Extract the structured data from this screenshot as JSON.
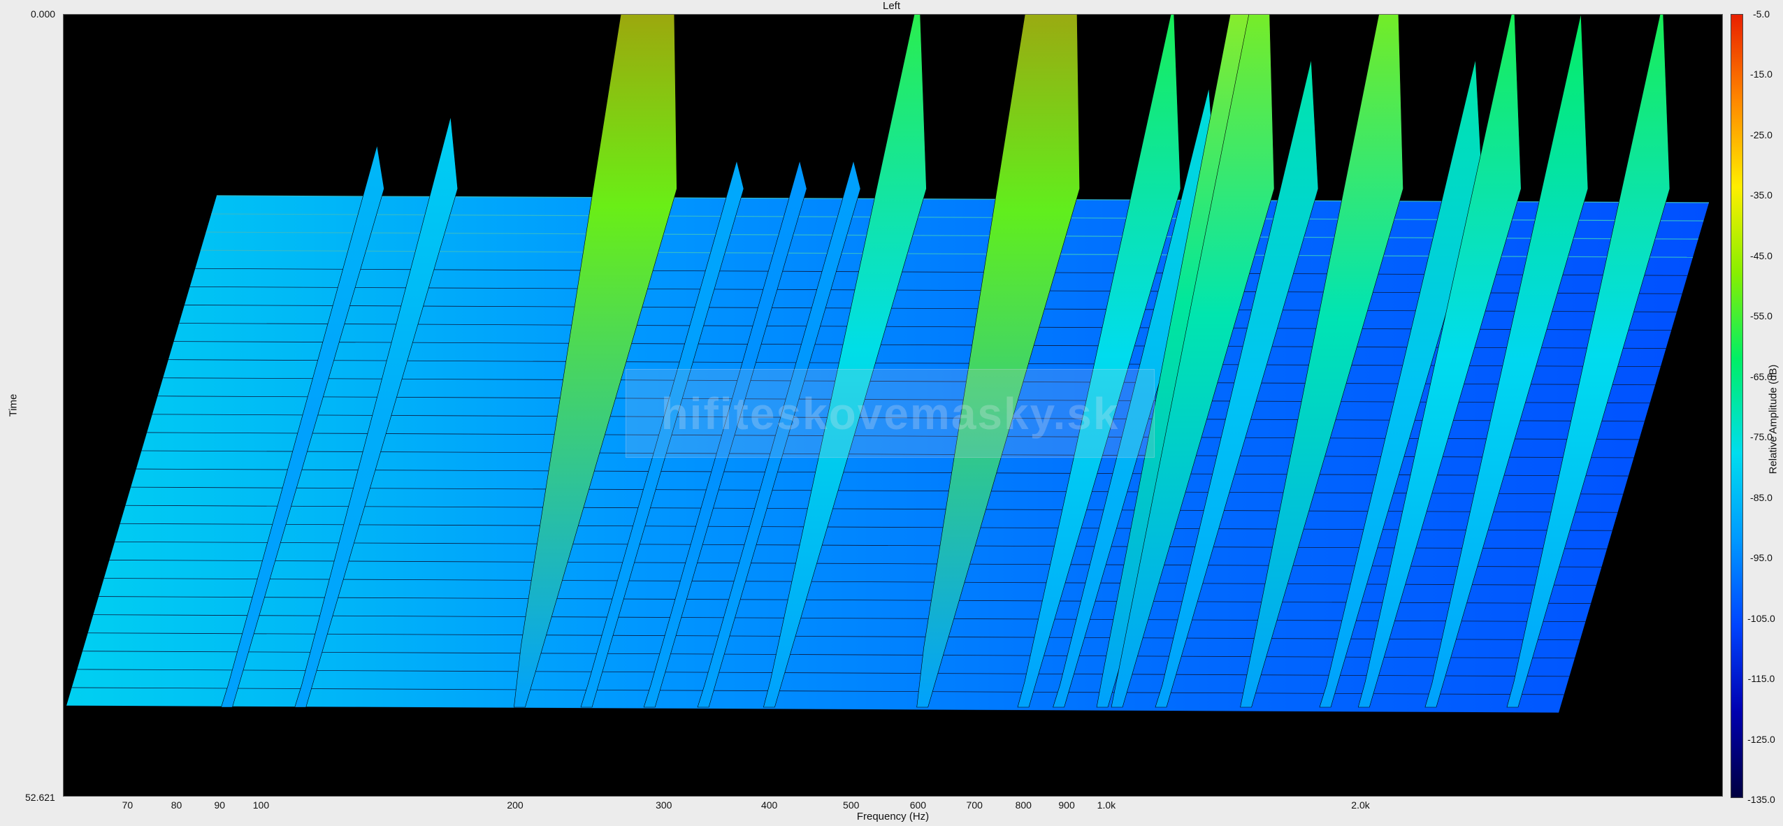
{
  "chart_data": {
    "type": "waterfall",
    "title": "Left",
    "xlabel": "Frequency (Hz)",
    "ylabel": "Time",
    "colorbar_label": "Relative Amplitude (dB)",
    "x_scale": "log",
    "xlim": [
      58,
      3700
    ],
    "x_ticks": [
      {
        "value": 70,
        "label": "70"
      },
      {
        "value": 80,
        "label": "80"
      },
      {
        "value": 90,
        "label": "90"
      },
      {
        "value": 100,
        "label": "100"
      },
      {
        "value": 200,
        "label": "200"
      },
      {
        "value": 300,
        "label": "300"
      },
      {
        "value": 400,
        "label": "400"
      },
      {
        "value": 500,
        "label": "500"
      },
      {
        "value": 600,
        "label": "600"
      },
      {
        "value": 700,
        "label": "700"
      },
      {
        "value": 800,
        "label": "800"
      },
      {
        "value": 900,
        "label": "900"
      },
      {
        "value": 1000,
        "label": "1.0k"
      },
      {
        "value": 2000,
        "label": "2.0k"
      }
    ],
    "time_range": [
      "0.000",
      "52.621"
    ],
    "colorbar_ticks": [
      "-5.0",
      "-15.0",
      "-25.0",
      "-35.0",
      "-45.0",
      "-55.0",
      "-65.0",
      "-75.0",
      "-85.0",
      "-95.0",
      "-105.0",
      "-115.0",
      "-125.0",
      "-135.0"
    ],
    "zlim": [
      -135,
      -5
    ],
    "colors": [
      "#000040",
      "#0000b0",
      "#0044ff",
      "#0099ff",
      "#00ddee",
      "#00ee66",
      "#88ee00",
      "#ffee00",
      "#ff8800",
      "#e82000"
    ],
    "peaks": [
      {
        "freq": 90,
        "level": -85
      },
      {
        "freq": 110,
        "level": -80
      },
      {
        "freq": 200,
        "level": -8
      },
      {
        "freq": 240,
        "level": -88
      },
      {
        "freq": 285,
        "level": -92
      },
      {
        "freq": 330,
        "level": -90
      },
      {
        "freq": 395,
        "level": -58
      },
      {
        "freq": 600,
        "level": -10
      },
      {
        "freq": 790,
        "level": -60
      },
      {
        "freq": 870,
        "level": -75
      },
      {
        "freq": 980,
        "level": -42
      },
      {
        "freq": 1020,
        "level": -46
      },
      {
        "freq": 1150,
        "level": -70
      },
      {
        "freq": 1450,
        "level": -47
      },
      {
        "freq": 1800,
        "level": -70
      },
      {
        "freq": 2000,
        "level": -60
      },
      {
        "freq": 2400,
        "level": -62
      },
      {
        "freq": 3000,
        "level": -60
      }
    ],
    "noise_floor_db": -95,
    "grid": false,
    "legend": "colorbar-right"
  },
  "watermark_text": "hifiteskovemasky.sk"
}
